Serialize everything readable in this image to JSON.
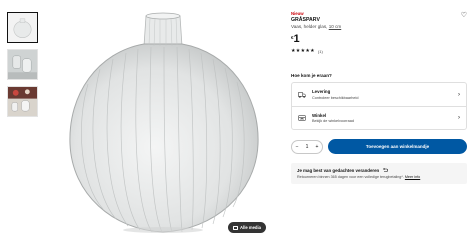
{
  "product": {
    "badge": "Nieuw",
    "name": "GRÅSPARV",
    "description": "Vaas, helder glas,",
    "size": "10 cm",
    "currency": "€",
    "price": "1",
    "stars": "★★★★★",
    "rating_count": "(1)"
  },
  "media_button": "Alle media",
  "delivery": {
    "heading": "Hoe kom je eraan?",
    "options": [
      {
        "title": "Levering",
        "subtitle": "Controleer beschikbaarheid"
      },
      {
        "title": "Winkel",
        "subtitle": "Bekijk de winkelvoorraad"
      }
    ]
  },
  "quantity": {
    "minus": "−",
    "value": "1",
    "plus": "+"
  },
  "cart_button": "Toevoegen aan winkelmandje",
  "return_policy": {
    "title": "Je mag best van gedachten veranderen",
    "text": "Retourneren binnen 365 dagen voor een volledige terugbetaling*.",
    "link": "Meer info"
  }
}
